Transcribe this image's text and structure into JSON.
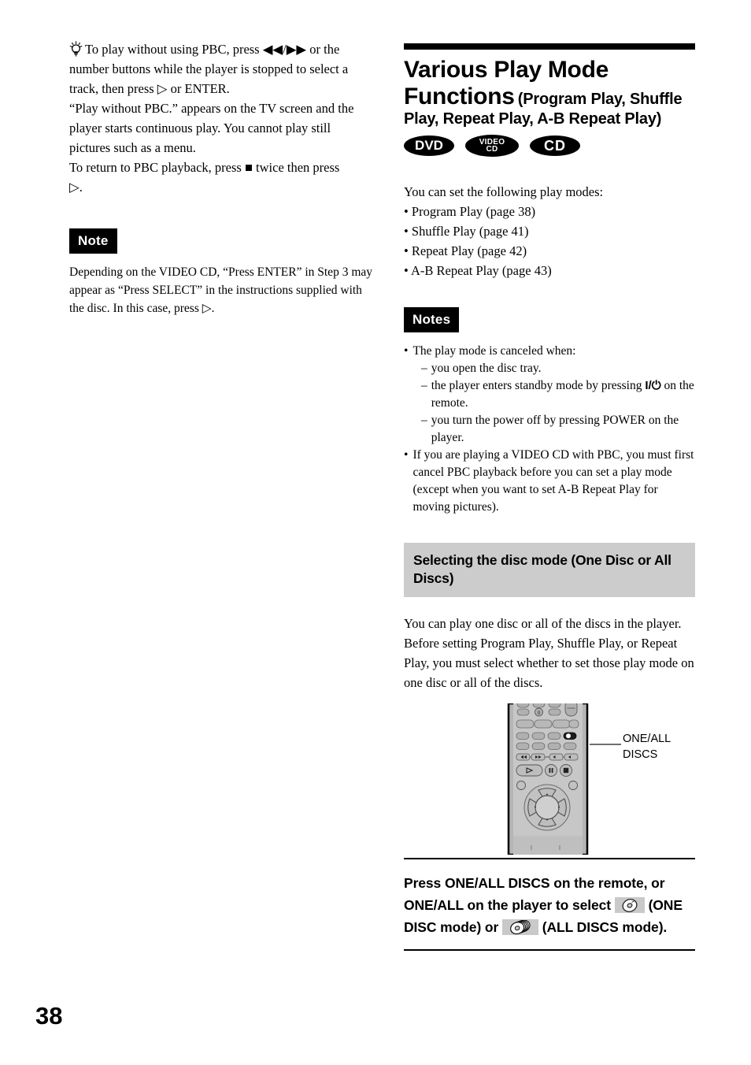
{
  "page": {
    "number": "38"
  },
  "left_column": {
    "tip_icon": "lightbulb-tip-icon",
    "tip_paragraph_1": "To play without using PBC, press",
    "tip_symbol_prev": "◀◀",
    "tip_slash": "/",
    "tip_symbol_next": "▶▶",
    "tip_paragraph_2": "or the number buttons while the player is stopped to select a track, then press",
    "tip_symbol_play": "▷",
    "tip_paragraph_3": "or ENTER.",
    "tip_paragraph_4": "“Play without PBC.” appears on the TV screen and the player starts continuous play. You cannot play still pictures such as a menu.",
    "tip_paragraph_5": "To return to PBC playback, press",
    "tip_symbol_stop": "■",
    "tip_paragraph_6": "twice then press",
    "tip_paragraph_7": ".",
    "note_label": "Note",
    "note_body_1": "Depending on the VIDEO CD, “Press ENTER” in Step 3 may appear as “Press SELECT” in the instructions supplied with the disc. In this case, press",
    "note_body_2": "."
  },
  "right_column": {
    "title_main": "Various Play Mode Functions",
    "title_sub": "(Program Play, Shuffle Play, Repeat Play, A-B Repeat Play)",
    "badges": [
      {
        "name": "dvd",
        "text": "DVD"
      },
      {
        "name": "video-cd",
        "line1": "VIDEO",
        "line2": "CD"
      },
      {
        "name": "cd",
        "text": "CD"
      }
    ],
    "intro": "You can set the following play modes:",
    "modes": [
      "• Program Play (page 38)",
      "• Shuffle Play (page 41)",
      "• Repeat Play (page 42)",
      "• A-B Repeat Play (page 43)"
    ],
    "notes_label": "Notes",
    "notes": {
      "bullet_1": "The play mode is canceled when:",
      "sub_1": "you open the disc tray.",
      "sub_2_a": "the player enters standby mode by pressing",
      "sub_2_symbol": "I/⏻",
      "sub_2_b": "on the remote.",
      "sub_3": "you turn the power off by pressing POWER on the player.",
      "bullet_2": "If you are playing a VIDEO CD with PBC, you must first cancel PBC playback before you can set a play mode (except when you want to set A-B Repeat Play for moving pictures)."
    },
    "section_header": "Selecting the disc mode (One Disc or All Discs)",
    "section_body": "You can play one disc or all of the discs in the player. Before setting Program Play, Shuffle Play, or Repeat Play, you must select whether to set those play mode on one disc or all of the discs.",
    "figure": {
      "remote_name": "remote-control-illustration",
      "callout_line1": "ONE/ALL",
      "callout_line2": "DISCS"
    },
    "instruction": {
      "part_1": "Press ONE/ALL DISCS on the remote, or ONE/ALL on the player to select",
      "one_disc_icon": "single-disc-icon",
      "part_2": "(ONE DISC mode) or",
      "all_discs_icon": "stacked-discs-icon",
      "part_3": "(ALL DISCS mode)."
    }
  },
  "colors": {
    "black": "#000000",
    "gray_header": "#cccccc",
    "chip_gray": "#c9c9c9",
    "callout_gray": "#6f6f6f"
  }
}
